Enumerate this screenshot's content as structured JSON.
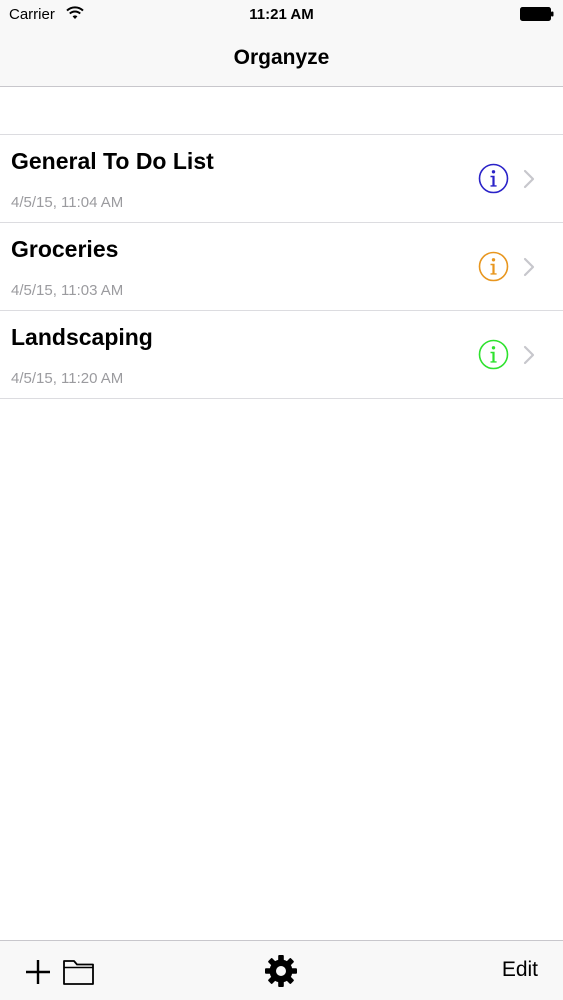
{
  "status_bar": {
    "carrier": "Carrier",
    "time": "11:21 AM"
  },
  "nav": {
    "title": "Organyze"
  },
  "lists": [
    {
      "title": "General To Do List",
      "date": "4/5/15, 11:04 AM",
      "info_color": "#2a22c8"
    },
    {
      "title": "Groceries",
      "date": "4/5/15, 11:03 AM",
      "info_color": "#e8961e"
    },
    {
      "title": "Landscaping",
      "date": "4/5/15, 11:20 AM",
      "info_color": "#2ee22e"
    }
  ],
  "toolbar": {
    "edit_label": "Edit"
  },
  "icons": {
    "add": "plus-icon",
    "folder": "folder-icon",
    "settings": "gear-icon",
    "info": "info-circle-icon",
    "disclosure": "chevron-right-icon"
  }
}
